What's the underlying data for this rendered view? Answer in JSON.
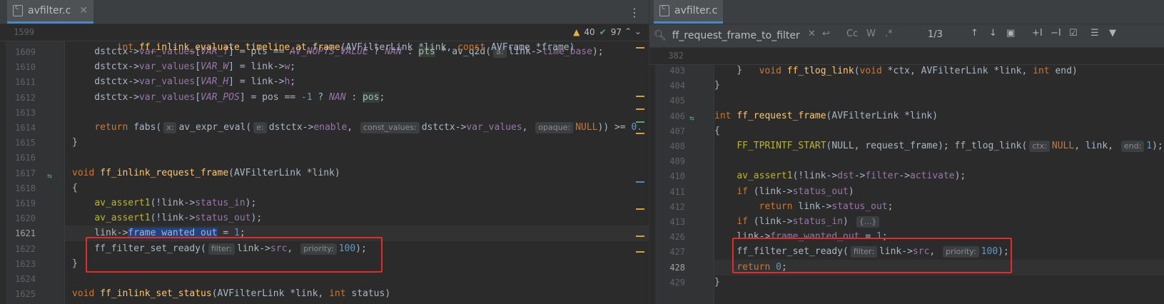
{
  "left": {
    "tab": "avfilter.c",
    "status": {
      "warnings": "40",
      "ok": "97"
    },
    "sticky": {
      "number": "1599",
      "pre": "int ",
      "fn": "ff_inlink_evaluate_timeline_at_frame",
      "post": "(AVFilterLink *link, ",
      "kw2": "const",
      "post2": " AVFrame *frame)"
    },
    "lines": [
      {
        "n": "1609",
        "segs": [
          {
            "t": "    dstctx->"
          },
          {
            "t": "var_values",
            "c": "fld"
          },
          {
            "t": "["
          },
          {
            "t": "VAR_T",
            "c": "const"
          },
          {
            "t": "] = pts == "
          },
          {
            "t": "AV_NOPTS_VALUE",
            "c": "const"
          },
          {
            "t": " ? "
          },
          {
            "t": "NAN",
            "c": "const"
          },
          {
            "t": " : "
          },
          {
            "t": "pts",
            "c": "hl"
          },
          {
            "t": " * av_q2d("
          },
          {
            "h": "a:"
          },
          {
            "t": "link->"
          },
          {
            "t": "time_base",
            "c": "fld"
          },
          {
            "t": ");"
          }
        ]
      },
      {
        "n": "1610",
        "segs": [
          {
            "t": "    dstctx->"
          },
          {
            "t": "var_values",
            "c": "fld"
          },
          {
            "t": "["
          },
          {
            "t": "VAR_W",
            "c": "const"
          },
          {
            "t": "] = link->"
          },
          {
            "t": "w",
            "c": "fld"
          },
          {
            "t": ";"
          }
        ]
      },
      {
        "n": "1611",
        "segs": [
          {
            "t": "    dstctx->"
          },
          {
            "t": "var_values",
            "c": "fld"
          },
          {
            "t": "["
          },
          {
            "t": "VAR_H",
            "c": "const"
          },
          {
            "t": "] = link->"
          },
          {
            "t": "h",
            "c": "fld"
          },
          {
            "t": ";"
          }
        ]
      },
      {
        "n": "1612",
        "segs": [
          {
            "t": "    dstctx->"
          },
          {
            "t": "var_values",
            "c": "fld"
          },
          {
            "t": "["
          },
          {
            "t": "VAR_POS",
            "c": "const"
          },
          {
            "t": "] = pos == "
          },
          {
            "t": "-1",
            "c": "num"
          },
          {
            "t": " ? "
          },
          {
            "t": "NAN",
            "c": "const"
          },
          {
            "t": " : "
          },
          {
            "t": "pos",
            "c": "hl"
          },
          {
            "t": ";"
          }
        ]
      },
      {
        "n": "1613",
        "segs": []
      },
      {
        "n": "1614",
        "segs": [
          {
            "t": "    "
          },
          {
            "t": "return",
            "c": "kw"
          },
          {
            "t": " fabs("
          },
          {
            "h": "x:"
          },
          {
            "t": "av_expr_eval("
          },
          {
            "h": "e:"
          },
          {
            "t": "dstctx->"
          },
          {
            "t": "enable",
            "c": "fld"
          },
          {
            "t": ", "
          },
          {
            "h": "const_values:"
          },
          {
            "t": "dstctx->"
          },
          {
            "t": "var_values",
            "c": "fld"
          },
          {
            "t": ", "
          },
          {
            "h": "opaque:"
          },
          {
            "t": "NULL",
            "c": "kw"
          },
          {
            "t": ")) >= "
          },
          {
            "t": "0.",
            "c": "num"
          }
        ]
      },
      {
        "n": "1615",
        "segs": [
          {
            "t": "}"
          }
        ]
      },
      {
        "n": "1616",
        "segs": []
      },
      {
        "n": "1617",
        "segs": [
          {
            "t": "void",
            "c": "kw"
          },
          {
            "t": " "
          },
          {
            "t": "ff_inlink_request_frame",
            "c": "fn"
          },
          {
            "t": "(AVFilterLink *link)"
          }
        ]
      },
      {
        "n": "1618",
        "segs": [
          {
            "t": "{"
          }
        ]
      },
      {
        "n": "1619",
        "segs": [
          {
            "t": "    "
          },
          {
            "t": "av_assert1",
            "c": "macro"
          },
          {
            "t": "(!link->"
          },
          {
            "t": "status_in",
            "c": "fld"
          },
          {
            "t": ");"
          }
        ]
      },
      {
        "n": "1620",
        "segs": [
          {
            "t": "    "
          },
          {
            "t": "av_assert1",
            "c": "macro"
          },
          {
            "t": "(!link->"
          },
          {
            "t": "status_out",
            "c": "fld"
          },
          {
            "t": ");"
          }
        ]
      },
      {
        "n": "1621",
        "segs": [
          {
            "t": "    link->"
          },
          {
            "t": "frame_wanted_out",
            "c": "sel"
          },
          {
            "t": " = "
          },
          {
            "t": "1",
            "c": "num"
          },
          {
            "t": ";"
          }
        ]
      },
      {
        "n": "1622",
        "segs": [
          {
            "t": "    ff_filter_set_ready("
          },
          {
            "h": "filter:"
          },
          {
            "t": "link->"
          },
          {
            "t": "src",
            "c": "fld"
          },
          {
            "t": ", "
          },
          {
            "h": "priority:"
          },
          {
            "t": "100",
            "c": "num"
          },
          {
            "t": ");"
          }
        ]
      },
      {
        "n": "1623",
        "segs": [
          {
            "t": "}"
          }
        ]
      },
      {
        "n": "1624",
        "segs": []
      },
      {
        "n": "1625",
        "segs": [
          {
            "t": "void",
            "c": "kw"
          },
          {
            "t": " "
          },
          {
            "t": "ff_inlink_set_status",
            "c": "fn"
          },
          {
            "t": "(AVFilterLink *link, "
          },
          {
            "t": "int",
            "c": "kw"
          },
          {
            "t": " status)"
          }
        ]
      }
    ]
  },
  "right": {
    "tab": "avfilter.c",
    "find": {
      "query": "ff_request_frame_to_filter",
      "count": "1/3",
      "cc": "Cc",
      "w": "W",
      "star": ".*"
    },
    "sticky": {
      "number": "382",
      "pre": "void ",
      "fn": "ff_tlog_link",
      "post": "(",
      "kw2": "void",
      "post2": " *ctx, AVFilterLink *link, ",
      "kw3": "int",
      "post3": " end)"
    },
    "lines": [
      {
        "n": "403",
        "segs": [
          {
            "t": "    }"
          }
        ]
      },
      {
        "n": "404",
        "segs": [
          {
            "t": "}"
          }
        ]
      },
      {
        "n": "405",
        "segs": []
      },
      {
        "n": "406",
        "segs": [
          {
            "t": "int",
            "c": "kw"
          },
          {
            "t": " "
          },
          {
            "t": "ff_request_frame",
            "c": "fn"
          },
          {
            "t": "(AVFilterLink *link)"
          }
        ]
      },
      {
        "n": "407",
        "segs": [
          {
            "t": "{"
          }
        ]
      },
      {
        "n": "408",
        "segs": [
          {
            "t": "    "
          },
          {
            "t": "FF_TPRINTF_START",
            "c": "macro"
          },
          {
            "t": "(NULL, request_frame); ff_tlog_link("
          },
          {
            "h": "ctx:"
          },
          {
            "t": "NULL",
            "c": "kw"
          },
          {
            "t": ", link, "
          },
          {
            "h": "end:"
          },
          {
            "t": "1",
            "c": "num"
          },
          {
            "t": ");"
          }
        ]
      },
      {
        "n": "409",
        "segs": []
      },
      {
        "n": "410",
        "segs": [
          {
            "t": "    "
          },
          {
            "t": "av_assert1",
            "c": "macro"
          },
          {
            "t": "(!link->"
          },
          {
            "t": "dst",
            "c": "fld"
          },
          {
            "t": "->"
          },
          {
            "t": "filter",
            "c": "fld"
          },
          {
            "t": "->"
          },
          {
            "t": "activate",
            "c": "fld"
          },
          {
            "t": ");"
          }
        ]
      },
      {
        "n": "411",
        "segs": [
          {
            "t": "    "
          },
          {
            "t": "if",
            "c": "kw"
          },
          {
            "t": " (link->"
          },
          {
            "t": "status_out",
            "c": "fld"
          },
          {
            "t": ")"
          }
        ]
      },
      {
        "n": "412",
        "segs": [
          {
            "t": "        "
          },
          {
            "t": "return",
            "c": "kw"
          },
          {
            "t": " link->"
          },
          {
            "t": "status_out",
            "c": "fld"
          },
          {
            "t": ";"
          }
        ]
      },
      {
        "n": "413",
        "segs": [
          {
            "t": "    "
          },
          {
            "t": "if",
            "c": "kw"
          },
          {
            "t": " (link->"
          },
          {
            "t": "status_in",
            "c": "fld"
          },
          {
            "t": ") "
          },
          {
            "t": "{...}",
            "c": "hint2"
          }
        ]
      },
      {
        "n": "426",
        "segs": [
          {
            "t": "    link->"
          },
          {
            "t": "frame_wanted_out",
            "c": "fld"
          },
          {
            "t": " = "
          },
          {
            "t": "1",
            "c": "num"
          },
          {
            "t": ";"
          }
        ]
      },
      {
        "n": "427",
        "segs": [
          {
            "t": "    ff_filter_set_ready("
          },
          {
            "h": "filter:"
          },
          {
            "t": "link->"
          },
          {
            "t": "src",
            "c": "fld"
          },
          {
            "t": ", "
          },
          {
            "h": "priority:"
          },
          {
            "t": "100",
            "c": "num"
          },
          {
            "t": ");"
          }
        ]
      },
      {
        "n": "428",
        "segs": [
          {
            "t": "    "
          },
          {
            "t": "return",
            "c": "kw"
          },
          {
            "t": " "
          },
          {
            "t": "0",
            "c": "num"
          },
          {
            "t": ";"
          }
        ]
      },
      {
        "n": "429",
        "segs": [
          {
            "t": "}"
          }
        ]
      }
    ]
  },
  "colors": {
    "highlight_box": "#e02c2c",
    "selection": "#214283",
    "keyword": "#cc7832",
    "function": "#ffc66d"
  }
}
